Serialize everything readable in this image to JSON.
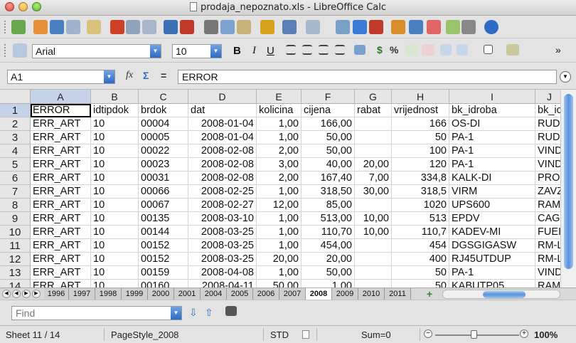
{
  "window": {
    "title": "prodaja_nepoznato.xls - LibreOffice Calc"
  },
  "toolbar_standard": {
    "icons": [
      "new-document-icon",
      "open-icon",
      "save-icon",
      "email-icon",
      "edit-file-icon",
      "export-pdf-icon",
      "print-icon",
      "page-preview-icon",
      "spellcheck-icon",
      "autospellcheck-icon",
      "cut-icon",
      "copy-icon",
      "paste-icon",
      "clone-formatting-icon",
      "undo-icon",
      "redo-icon",
      "hyperlink-icon",
      "sort-ascending-icon",
      "sort-descending-icon",
      "insert-chart-icon",
      "show-draw-functions-icon",
      "navigator-icon",
      "gallery-icon",
      "data-sources-icon",
      "help-icon"
    ]
  },
  "toolbar_formatting": {
    "font_name": "Arial",
    "font_size": "10",
    "bold": "B",
    "italic": "I",
    "underline": "U",
    "currency": "$",
    "percent": "%",
    "more": "»"
  },
  "formula_bar": {
    "cell_ref": "A1",
    "function_wizard": "fx",
    "sum": "Σ",
    "equals": "=",
    "content": "ERROR"
  },
  "sheet": {
    "columns": [
      "A",
      "B",
      "C",
      "D",
      "E",
      "F",
      "G",
      "H",
      "I",
      "J"
    ],
    "rows": [
      {
        "n": "1",
        "cells": [
          "ERROR",
          "idtipdok",
          "brdok",
          "dat",
          "kolicina",
          "cijena",
          "rabat",
          "vrijednost",
          "bk_idroba",
          "bk_ic"
        ]
      },
      {
        "n": "2",
        "cells": [
          "ERR_ART",
          "10",
          "00004",
          "2008-01-04",
          "1,00",
          "166,00",
          "",
          "166",
          "OS-DI",
          "RUD"
        ]
      },
      {
        "n": "3",
        "cells": [
          "ERR_ART",
          "10",
          "00005",
          "2008-01-04",
          "1,00",
          "50,00",
          "",
          "50",
          "PA-1",
          "RUD"
        ]
      },
      {
        "n": "4",
        "cells": [
          "ERR_ART",
          "10",
          "00022",
          "2008-02-08",
          "2,00",
          "50,00",
          "",
          "100",
          "PA-1",
          "VIND"
        ]
      },
      {
        "n": "5",
        "cells": [
          "ERR_ART",
          "10",
          "00023",
          "2008-02-08",
          "3,00",
          "40,00",
          "20,00",
          "120",
          "PA-1",
          "VIND"
        ]
      },
      {
        "n": "6",
        "cells": [
          "ERR_ART",
          "10",
          "00031",
          "2008-02-08",
          "2,00",
          "167,40",
          "7,00",
          "334,8",
          "KALK-DI",
          "PRO"
        ]
      },
      {
        "n": "7",
        "cells": [
          "ERR_ART",
          "10",
          "00066",
          "2008-02-25",
          "1,00",
          "318,50",
          "30,00",
          "318,5",
          "VIRM",
          "ZAVZ"
        ]
      },
      {
        "n": "8",
        "cells": [
          "ERR_ART",
          "10",
          "00067",
          "2008-02-27",
          "12,00",
          "85,00",
          "",
          "1020",
          "UPS600",
          "RAM"
        ]
      },
      {
        "n": "9",
        "cells": [
          "ERR_ART",
          "10",
          "00135",
          "2008-03-10",
          "1,00",
          "513,00",
          "10,00",
          "513",
          "EPDV",
          "CAG"
        ]
      },
      {
        "n": "10",
        "cells": [
          "ERR_ART",
          "10",
          "00144",
          "2008-03-25",
          "1,00",
          "110,70",
          "10,00",
          "110,7",
          "KADEV-MI",
          "FUEI"
        ]
      },
      {
        "n": "11",
        "cells": [
          "ERR_ART",
          "10",
          "00152",
          "2008-03-25",
          "1,00",
          "454,00",
          "",
          "454",
          "DGSGIGASW",
          "RM-L"
        ]
      },
      {
        "n": "12",
        "cells": [
          "ERR_ART",
          "10",
          "00152",
          "2008-03-25",
          "20,00",
          "20,00",
          "",
          "400",
          "RJ45UTDUP",
          "RM-L"
        ]
      },
      {
        "n": "13",
        "cells": [
          "ERR_ART",
          "10",
          "00159",
          "2008-04-08",
          "1,00",
          "50,00",
          "",
          "50",
          "PA-1",
          "VIND"
        ]
      },
      {
        "n": "14",
        "cells": [
          "ERR_ART",
          "10",
          "00160",
          "2008-04-11",
          "50,00",
          "1,00",
          "",
          "50",
          "KABUTP05",
          "RAM"
        ]
      }
    ]
  },
  "tabs": {
    "names": [
      "1996",
      "1997",
      "1998",
      "1999",
      "2000",
      "2001",
      "2004",
      "2005",
      "2006",
      "2007",
      "2008",
      "2009",
      "2010",
      "2011"
    ],
    "active": "2008"
  },
  "findbar": {
    "placeholder": "Find"
  },
  "status": {
    "sheet": "Sheet 11 / 14",
    "page_style": "PageStyle_2008",
    "mode": "STD",
    "sum": "Sum=0",
    "zoom": "100%"
  }
}
